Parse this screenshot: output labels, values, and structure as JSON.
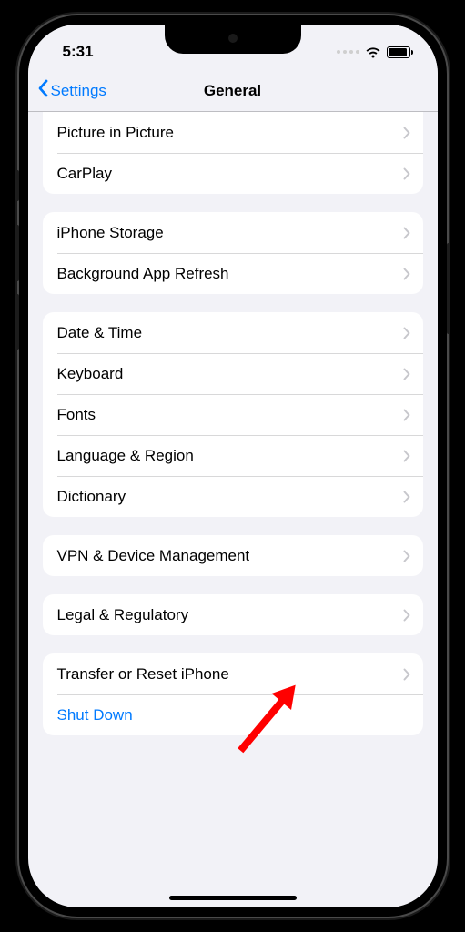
{
  "status": {
    "time": "5:31"
  },
  "nav": {
    "back": "Settings",
    "title": "General"
  },
  "groups": [
    {
      "first": true,
      "rows": [
        {
          "label": "Picture in Picture",
          "chevron": true
        },
        {
          "label": "CarPlay",
          "chevron": true
        }
      ]
    },
    {
      "rows": [
        {
          "label": "iPhone Storage",
          "chevron": true
        },
        {
          "label": "Background App Refresh",
          "chevron": true
        }
      ]
    },
    {
      "rows": [
        {
          "label": "Date & Time",
          "chevron": true
        },
        {
          "label": "Keyboard",
          "chevron": true
        },
        {
          "label": "Fonts",
          "chevron": true
        },
        {
          "label": "Language & Region",
          "chevron": true
        },
        {
          "label": "Dictionary",
          "chevron": true
        }
      ]
    },
    {
      "rows": [
        {
          "label": "VPN & Device Management",
          "chevron": true
        }
      ]
    },
    {
      "rows": [
        {
          "label": "Legal & Regulatory",
          "chevron": true
        }
      ]
    },
    {
      "rows": [
        {
          "label": "Transfer or Reset iPhone",
          "chevron": true
        },
        {
          "label": "Shut Down",
          "chevron": false,
          "action": true
        }
      ]
    }
  ]
}
